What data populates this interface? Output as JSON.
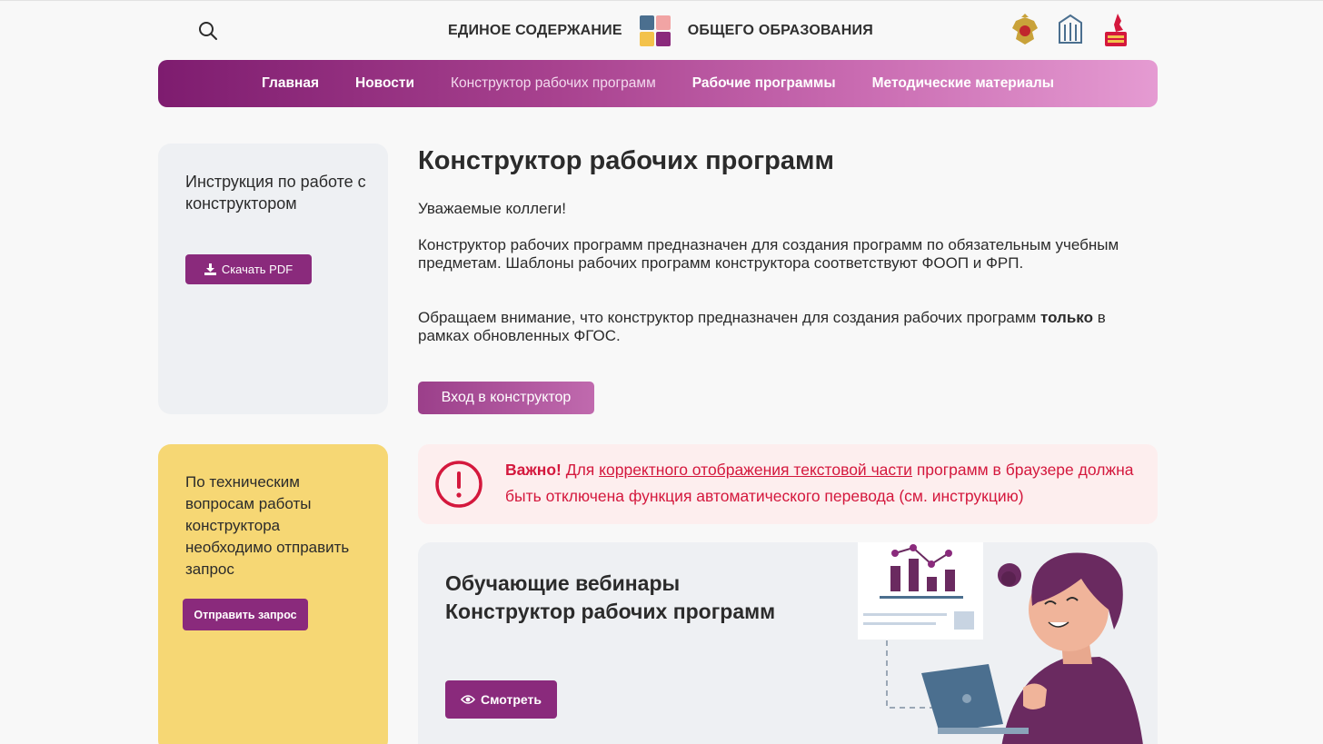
{
  "header": {
    "brand_left": "ЕДИНОЕ СОДЕРЖАНИЕ",
    "brand_right": "ОБЩЕГО ОБРАЗОВАНИЯ"
  },
  "nav": {
    "items": [
      {
        "label": "Главная"
      },
      {
        "label": "Новости"
      },
      {
        "label": "Конструктор рабочих программ"
      },
      {
        "label": "Рабочие программы"
      },
      {
        "label": "Методические материалы"
      }
    ]
  },
  "sidebar": {
    "instruction_text": "Инструкция по работе с конструктором",
    "pdf_button": "Скачать PDF",
    "support_text": "По техническим вопросам работы конструктора необходимо отправить запрос",
    "request_button": "Отправить запрос"
  },
  "main": {
    "title": "Конструктор рабочих программ",
    "greeting": "Уважаемые коллеги!",
    "paragraph1": "Конструктор рабочих программ предназначен для создания программ по обязательным учебным предметам. Шаблоны рабочих программ конструктора  соответствуют ФООП и ФРП.",
    "paragraph2_start": "Обращаем внимание, что  конструктор предназначен для создания рабочих программ ",
    "paragraph2_bold": "только",
    "paragraph2_end": " в рамках обновленных ФГОС.",
    "enter_button": "Вход в конструктор"
  },
  "alert": {
    "bold": "Важно!",
    "before_link": " Для ",
    "link": "корректного отображения текстовой части",
    "after_link": " программ в браузере должна быть отключена функция автоматического перевода (см. инструкцию)"
  },
  "webinar": {
    "title_line1": "Обучающие вебинары",
    "title_line2": "Конструктор рабочих программ",
    "watch_button": "Смотреть"
  },
  "colors": {
    "primary": "#8a2a7c",
    "support_bg": "#f6d774",
    "alert_text": "#d4183d",
    "alert_bg": "#fdeeee"
  }
}
